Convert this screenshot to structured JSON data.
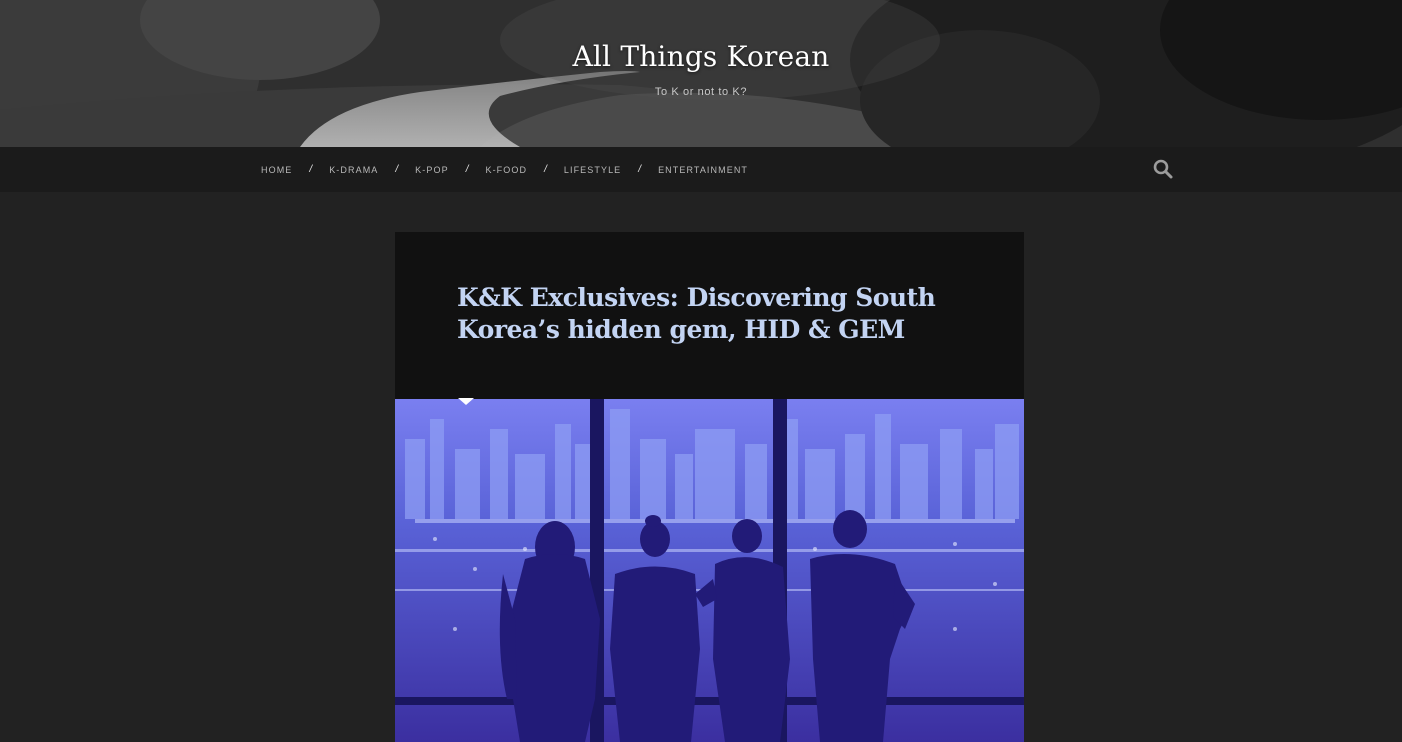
{
  "site": {
    "title": "All Things Korean",
    "tagline": "To K or not to K?"
  },
  "nav": {
    "items": [
      {
        "label": "HOME"
      },
      {
        "label": "K-DRAMA"
      },
      {
        "label": "K-POP"
      },
      {
        "label": "K-FOOD"
      },
      {
        "label": "LIFESTYLE"
      },
      {
        "label": "ENTERTAINMENT"
      }
    ],
    "separator": "/",
    "search_icon": "search-icon"
  },
  "post": {
    "title": "K&K Exclusives: Discovering South Korea’s hidden gem, HID & GEM",
    "image_icon": "featured-image"
  },
  "colors": {
    "background": "#222222",
    "nav_background": "#1b1b1b",
    "card_background": "#111111",
    "post_title": "#c3d4f3",
    "image_tint": "#5a55d6"
  }
}
